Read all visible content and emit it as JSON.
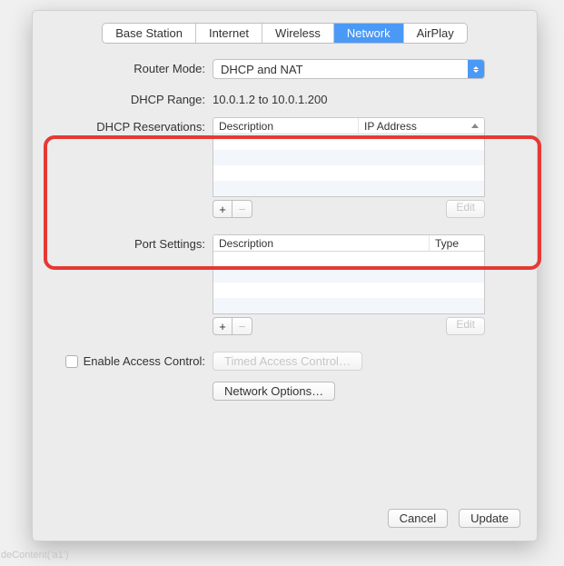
{
  "tabs": {
    "items": [
      {
        "label": "Base Station"
      },
      {
        "label": "Internet"
      },
      {
        "label": "Wireless"
      },
      {
        "label": "Network"
      },
      {
        "label": "AirPlay"
      }
    ],
    "active_index": 3
  },
  "router_mode": {
    "label": "Router Mode:",
    "value": "DHCP and NAT"
  },
  "dhcp_range": {
    "label": "DHCP Range:",
    "value": "10.0.1.2 to 10.0.1.200"
  },
  "dhcp_reservations": {
    "label": "DHCP Reservations:",
    "columns": {
      "description": "Description",
      "ip": "IP Address"
    },
    "rows": [],
    "add": "+",
    "remove": "−",
    "edit": "Edit"
  },
  "port_settings": {
    "label": "Port Settings:",
    "columns": {
      "description": "Description",
      "type": "Type"
    },
    "rows": [],
    "add": "+",
    "remove": "−",
    "edit": "Edit"
  },
  "access_control": {
    "label": "Enable Access Control:",
    "button": "Timed Access Control…",
    "checked": false
  },
  "network_options": {
    "button": "Network Options…"
  },
  "footer": {
    "cancel": "Cancel",
    "update": "Update"
  },
  "ghost": "deContent('a1')"
}
